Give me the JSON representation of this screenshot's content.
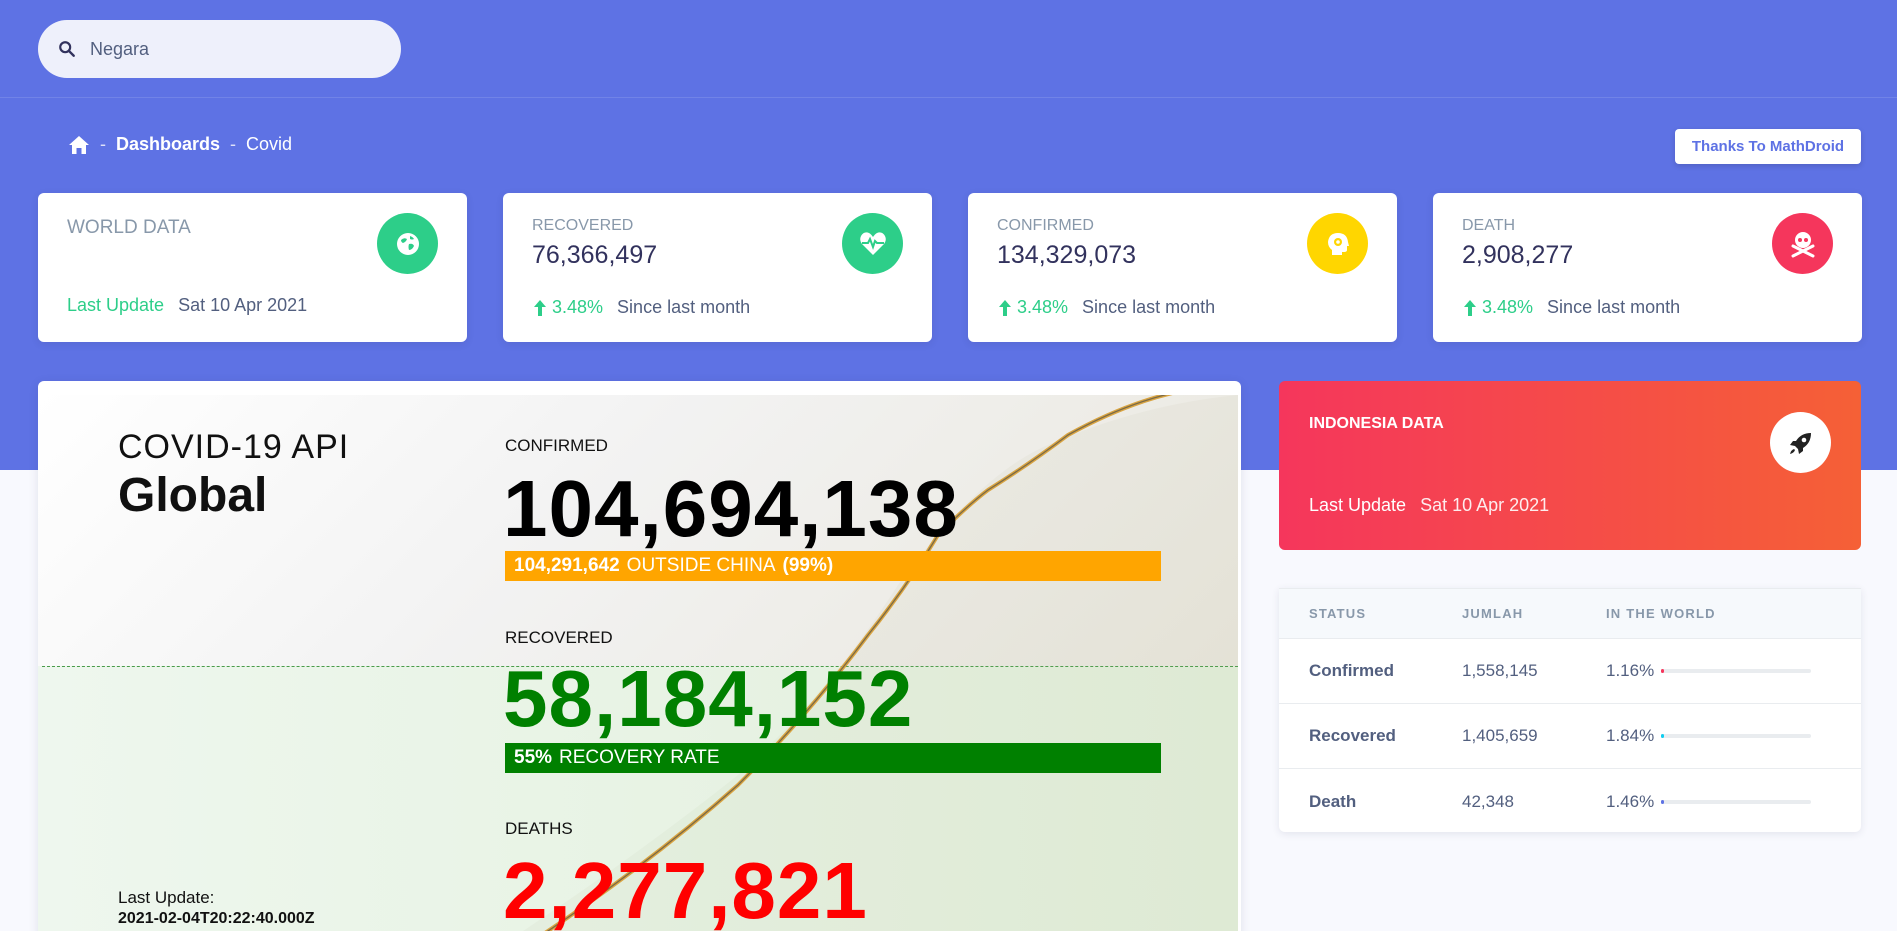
{
  "search": {
    "placeholder": "Negara"
  },
  "breadcrumb": {
    "level1": "Dashboards",
    "level2": "Covid"
  },
  "thanks_button": "Thanks To MathDroid",
  "cards": {
    "world": {
      "title": "WORLD DATA",
      "update_label": "Last Update",
      "update_date": "Sat 10 Apr 2021",
      "icon": "globe-icon",
      "color": "#2dce89"
    },
    "recovered": {
      "title": "RECOVERED",
      "value": "76,366,497",
      "change": "3.48%",
      "since": "Since last month",
      "icon": "heartbeat-icon",
      "color": "#2dce89"
    },
    "confirmed": {
      "title": "CONFIRMED",
      "value": "134,329,073",
      "change": "3.48%",
      "since": "Since last month",
      "icon": "virus-head-icon",
      "color": "#ffd600"
    },
    "death": {
      "title": "DEATH",
      "value": "2,908,277",
      "change": "3.48%",
      "since": "Since last month",
      "icon": "skull-crossbones-icon",
      "color": "#f5365c"
    }
  },
  "covid_image": {
    "api_title": "COVID-19 API",
    "scope": "Global",
    "confirmed_label": "CONFIRMED",
    "confirmed_value": "104,694,138",
    "outside_china_value": "104,291,642",
    "outside_china_text": "OUTSIDE CHINA",
    "outside_china_pct": "(99%)",
    "recovered_label": "RECOVERED",
    "recovered_value": "58,184,152",
    "recovery_rate_pct": "55%",
    "recovery_rate_text": "RECOVERY RATE",
    "deaths_label": "DEATHS",
    "deaths_value": "2,277,821",
    "last_update_label": "Last Update:",
    "last_update_value": "2021-02-04T20:22:40.000Z"
  },
  "indonesia": {
    "title": "INDONESIA DATA",
    "update_label": "Last Update",
    "update_date": "Sat 10 Apr 2021",
    "icon": "rocket-icon"
  },
  "table": {
    "headers": [
      "STATUS",
      "JUMLAH",
      "IN THE WORLD"
    ],
    "rows": [
      {
        "status": "Confirmed",
        "count": "1,558,145",
        "pct": "1.16%",
        "fraction": 0.0116,
        "color": "#f5365c"
      },
      {
        "status": "Recovered",
        "count": "1,405,659",
        "pct": "1.84%",
        "fraction": 0.0184,
        "color": "#11cdef"
      },
      {
        "status": "Death",
        "count": "42,348",
        "pct": "1.46%",
        "fraction": 0.0146,
        "color": "#5e72e4"
      }
    ]
  }
}
